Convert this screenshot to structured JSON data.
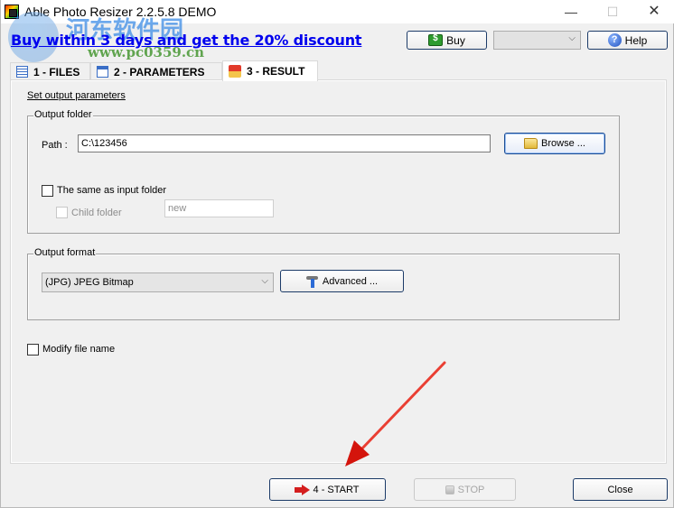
{
  "window": {
    "title": "Able Photo Resizer 2.2.5.8 DEMO",
    "minimize_glyph": "—",
    "maximize_glyph": "☐",
    "close_glyph": "✕"
  },
  "header": {
    "promo_link": "Buy within 3 days and get the 20% discount",
    "buy_label": "Buy",
    "language_value": "",
    "language_chevron": "⌵",
    "help_label": "Help",
    "help_glyph": "?"
  },
  "watermark": {
    "site_name_cn": "河东软件园",
    "url": "www.pc0359.cn"
  },
  "tabs": [
    {
      "label": "1 - FILES",
      "icon": "document-icon",
      "active": false
    },
    {
      "label": "2 - PARAMETERS",
      "icon": "list-icon",
      "active": false
    },
    {
      "label": "3 - RESULT",
      "icon": "result-icon",
      "active": true
    }
  ],
  "result": {
    "section_link": "Set output parameters",
    "output_folder": {
      "group_label": "Output folder",
      "path_label": "Path :",
      "path_value": "C:\\123456",
      "browse_label": "Browse ...",
      "same_as_input_label": "The same as input folder",
      "same_as_input_checked": false,
      "child_folder_label": "Child folder",
      "child_folder_checked": false,
      "child_folder_enabled": false,
      "child_folder_value": "new"
    },
    "output_format": {
      "group_label": "Output format",
      "selected_format": "(JPG) JPEG Bitmap",
      "chevron": "⌵",
      "advanced_label": "Advanced ..."
    },
    "modify_file_name_label": "Modify file name",
    "modify_file_name_checked": false
  },
  "footer": {
    "start_label": "4 - START",
    "stop_label": "STOP",
    "stop_enabled": false,
    "close_label": "Close"
  },
  "annotation": {
    "color": "#e8231c",
    "points_to": "start-button"
  }
}
